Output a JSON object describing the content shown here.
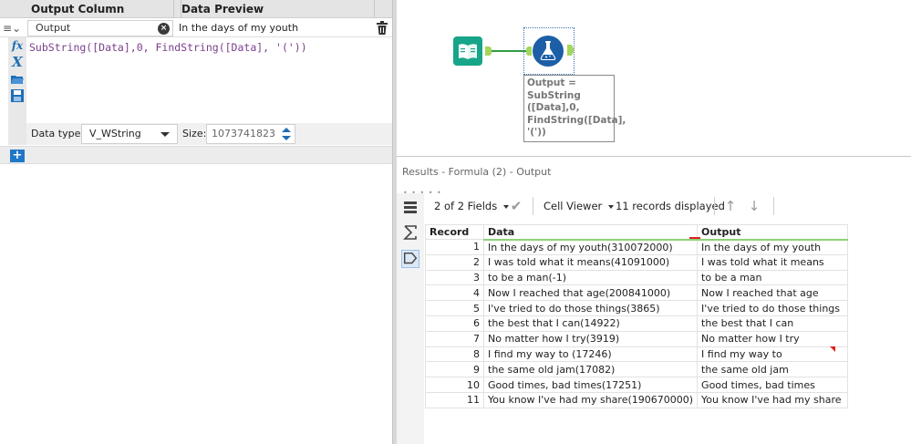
{
  "config": {
    "col_output_header": "Output Column",
    "col_preview_header": "Data Preview",
    "output_field": "Output",
    "preview_value": "In the days of my youth",
    "expression": "SubString([Data],0, FindString([Data], '('))",
    "data_type_label": "Data type:",
    "data_type_value": "V_WString",
    "size_label": "Size:",
    "size_value": "1073741823",
    "add_label": "+"
  },
  "canvas": {
    "annotation": "Output =\nSubString\n([Data],0,\nFindString([Data],\n'('))"
  },
  "results": {
    "title": "Results - Formula (2) - Output",
    "fields_label": "2 of 2 Fields",
    "viewer_label": "Cell Viewer",
    "records_label": "11 records displayed",
    "columns": [
      "Record",
      "Data",
      "Output"
    ],
    "rows": [
      {
        "record": "1",
        "data": "In the days of my youth(310072000)",
        "output": "In the days of my youth"
      },
      {
        "record": "2",
        "data": "I was told what it means(41091000)",
        "output": "I was told what it means"
      },
      {
        "record": "3",
        "data": "to be a man(-1)",
        "output": "to be a man"
      },
      {
        "record": "4",
        "data": "Now I reached that age(200841000)",
        "output": "Now I reached that age"
      },
      {
        "record": "5",
        "data": "I've tried to do those things(3865)",
        "output": "I've tried to do those things"
      },
      {
        "record": "6",
        "data": "the best that I can(14922)",
        "output": "the best that I can"
      },
      {
        "record": "7",
        "data": "No matter how I try(3919)",
        "output": "No matter how I try"
      },
      {
        "record": "8",
        "data": "I find my way to (17246)",
        "output": "I find my way to"
      },
      {
        "record": "9",
        "data": "the same old jam(17082)",
        "output": "the same old jam"
      },
      {
        "record": "10",
        "data": "Good times, bad times(17251)",
        "output": "Good times, bad times"
      },
      {
        "record": "11",
        "data": "You know I've had my share(190670000)",
        "output": "You know I've had my share"
      }
    ]
  },
  "icons": {
    "input": "book-icon",
    "formula": "flask-icon",
    "check": "check-icon",
    "up": "arrow-up-icon",
    "down": "arrow-down-icon"
  },
  "colors": {
    "accent": "#1f77c8",
    "input_tool": "#17a589",
    "formula_tool": "#1d5fa6",
    "anchor": "#a3d65c",
    "connection": "#2c9f42",
    "expression": "#7a3f8c"
  }
}
